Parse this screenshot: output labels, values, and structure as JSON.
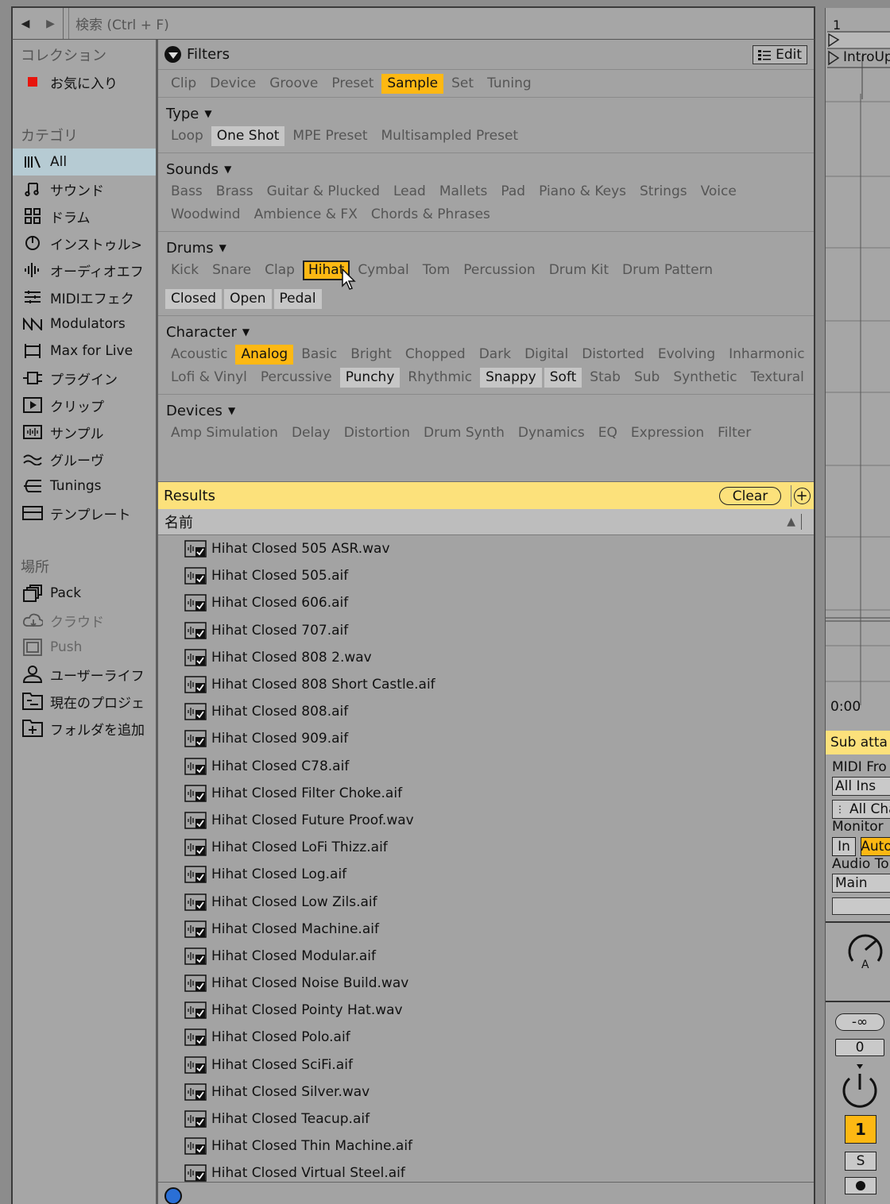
{
  "topbar": {
    "search_placeholder": "検索 (Ctrl + F)",
    "back_icon": "◀",
    "forward_icon": "▶"
  },
  "left": {
    "collections_heading": "コレクション",
    "favorites_label": "お気に入り",
    "favorites_color": "#e8140c",
    "categories_heading": "カテゴリ",
    "categories": [
      {
        "label": "All",
        "icon": "all-icon"
      },
      {
        "label": "サウンド",
        "icon": "sounds-icon"
      },
      {
        "label": "ドラム",
        "icon": "drums-icon"
      },
      {
        "label": "インストゥル>",
        "icon": "instruments-icon"
      },
      {
        "label": "オーディオエフ",
        "icon": "audio-effects-icon"
      },
      {
        "label": "MIDIエフェク",
        "icon": "midi-effects-icon"
      },
      {
        "label": "Modulators",
        "icon": "modulators-icon"
      },
      {
        "label": "Max for Live",
        "icon": "max-for-live-icon"
      },
      {
        "label": "プラグイン",
        "icon": "plugins-icon"
      },
      {
        "label": "クリップ",
        "icon": "clips-icon"
      },
      {
        "label": "サンプル",
        "icon": "samples-icon"
      },
      {
        "label": "グルーヴ",
        "icon": "grooves-icon"
      },
      {
        "label": "Tunings",
        "icon": "tunings-icon"
      },
      {
        "label": "テンプレート",
        "icon": "templates-icon"
      }
    ],
    "places_heading": "場所",
    "places": [
      {
        "label": "Pack",
        "icon": "pack-icon"
      },
      {
        "label": "クラウド",
        "icon": "cloud-icon"
      },
      {
        "label": "Push",
        "icon": "push-icon"
      },
      {
        "label": "ユーザーライフ",
        "icon": "user-library-icon"
      },
      {
        "label": "現在のプロジェ",
        "icon": "current-project-icon"
      },
      {
        "label": "フォルダを追加",
        "icon": "add-folder-icon"
      }
    ]
  },
  "filters": {
    "title": "Filters",
    "edit_label": "Edit",
    "categories": [
      "Clip",
      "Device",
      "Groove",
      "Preset",
      "Sample",
      "Set",
      "Tuning"
    ],
    "active_category": "Sample",
    "sections": {
      "type": {
        "title": "Type",
        "tags": [
          "Loop",
          "One Shot",
          "MPE Preset",
          "Multisampled Preset"
        ]
      },
      "sounds": {
        "title": "Sounds",
        "tags": [
          "Bass",
          "Brass",
          "Guitar & Plucked",
          "Lead",
          "Mallets",
          "Pad",
          "Piano & Keys",
          "Strings",
          "Voice",
          "Woodwind",
          "Ambience & FX",
          "Chords & Phrases"
        ]
      },
      "drums": {
        "title": "Drums",
        "tags": [
          "Kick",
          "Snare",
          "Clap",
          "Hihat",
          "Cymbal",
          "Tom",
          "Percussion",
          "Drum Kit",
          "Drum Pattern"
        ],
        "sub_tags": [
          "Closed",
          "Open",
          "Pedal"
        ]
      },
      "character": {
        "title": "Character",
        "tags": [
          "Acoustic",
          "Analog",
          "Basic",
          "Bright",
          "Chopped",
          "Dark",
          "Digital",
          "Distorted",
          "Evolving",
          "Inharmonic",
          "Lofi & Vinyl",
          "Percussive",
          "Punchy",
          "Rhythmic",
          "Snappy",
          "Soft",
          "Stab",
          "Sub",
          "Synthetic",
          "Textural"
        ]
      },
      "devices": {
        "title": "Devices",
        "tags": [
          "Amp Simulation",
          "Delay",
          "Distortion",
          "Drum Synth",
          "Dynamics",
          "EQ",
          "Expression",
          "Filter"
        ]
      }
    },
    "highlight_color": "#fdb813"
  },
  "results": {
    "label": "Results",
    "clear_label": "Clear",
    "column_name": "名前",
    "sort_icon": "▲",
    "files": [
      "Hihat Closed 505 ASR.wav",
      "Hihat Closed 505.aif",
      "Hihat Closed 606.aif",
      "Hihat Closed 707.aif",
      "Hihat Closed 808 2.wav",
      "Hihat Closed 808 Short Castle.aif",
      "Hihat Closed 808.aif",
      "Hihat Closed 909.aif",
      "Hihat Closed C78.aif",
      "Hihat Closed Filter Choke.aif",
      "Hihat Closed Future Proof.wav",
      "Hihat Closed LoFi Thizz.aif",
      "Hihat Closed Log.aif",
      "Hihat Closed Low Zils.aif",
      "Hihat Closed Machine.aif",
      "Hihat Closed Modular.aif",
      "Hihat Closed Noise Build.wav",
      "Hihat Closed Pointy Hat.wav",
      "Hihat Closed Polo.aif",
      "Hihat Closed SciFi.aif",
      "Hihat Closed Silver.wav",
      "Hihat Closed Teacup.aif",
      "Hihat Closed Thin Machine.aif",
      "Hihat Closed Virtual Steel.aif"
    ]
  },
  "right_panel": {
    "scene_number": "1",
    "clip_label": "IntroUp",
    "time_label": "0:00",
    "track_title": "Sub atta",
    "midi_from": "MIDI Fro",
    "input_type": "All Ins",
    "input_channel": "All Cha",
    "monitor_label": "Monitor",
    "monitor_in": "In",
    "monitor_auto": "Auto",
    "audio_to_label": "Audio To",
    "audio_to_value": "Main",
    "pan_letter": "A",
    "volume_inf": "-∞",
    "volume_zero": "0",
    "track_number": "1",
    "solo_label": "S"
  }
}
